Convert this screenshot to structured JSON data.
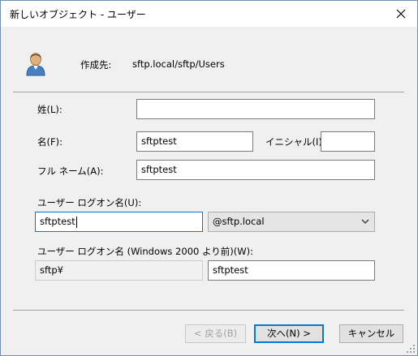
{
  "window": {
    "title": "新しいオブジェクト - ユーザー"
  },
  "icons": {
    "user": "user-icon",
    "close": "close-icon",
    "dropdown": "chevron-down-icon",
    "grip": "resize-grip-icon"
  },
  "header": {
    "create_in_label": "作成先:",
    "create_in_value": "sftp.local/sftp/Users"
  },
  "form": {
    "last_name_label": "姓(L):",
    "last_name_value": "",
    "first_name_label": "名(F):",
    "first_name_value": "sftptest",
    "initials_label": "イニシャル(I):",
    "initials_value": "",
    "full_name_label": "フル ネーム(A):",
    "full_name_value": "sftptest",
    "logon_name_label": "ユーザー ログオン名(U):",
    "logon_name_value": "sftptest",
    "upn_suffix_value": "@sftp.local",
    "pre2000_label": "ユーザー ログオン名 (Windows 2000 より前)(W):",
    "pre2000_domain_value": "sftp¥",
    "pre2000_name_value": "sftptest"
  },
  "buttons": {
    "back": "< 戻る(B)",
    "next": "次へ(N) >",
    "cancel": "キャンセル"
  },
  "colors": {
    "focus_border": "#0078d7",
    "dialog_bg": "#f0f0f0"
  }
}
